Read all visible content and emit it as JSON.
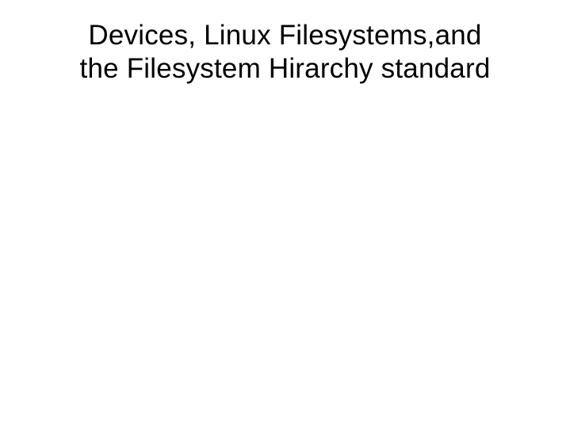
{
  "slide": {
    "title_line1": "Devices, Linux Filesystems,and",
    "title_line2": "the Filesystem Hirarchy standard"
  }
}
